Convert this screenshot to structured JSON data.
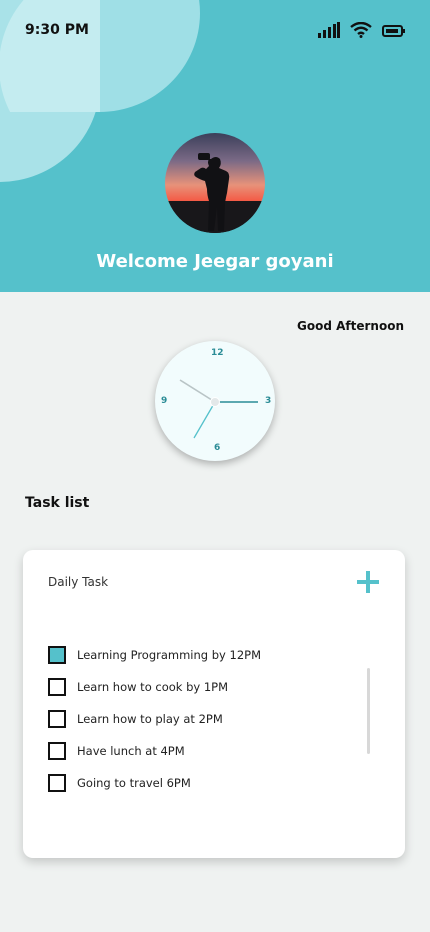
{
  "status_bar": {
    "time": "9:30 PM",
    "icons": [
      "signal-icon",
      "wifi-icon",
      "battery-icon"
    ]
  },
  "profile": {
    "welcome": "Welcome Jeegar goyani",
    "avatar": "avatar-photo-silhouette-sunset"
  },
  "greeting": "Good Afternoon",
  "clock": {
    "numbers": [
      "12",
      "3",
      "6",
      "9"
    ]
  },
  "task_list": {
    "title": "Task list",
    "card_title": "Daily Task",
    "add_icon": "plus-icon",
    "tasks": [
      {
        "label": "Learning Programming by 12PM",
        "checked": true
      },
      {
        "label": "Learn how to cook by 1PM",
        "checked": false
      },
      {
        "label": "Learn how to play at 2PM",
        "checked": false
      },
      {
        "label": "Have lunch at 4PM",
        "checked": false
      },
      {
        "label": "Going to travel 6PM",
        "checked": false
      }
    ]
  },
  "colors": {
    "accent": "#55c1cb",
    "background": "#eff2f1"
  }
}
